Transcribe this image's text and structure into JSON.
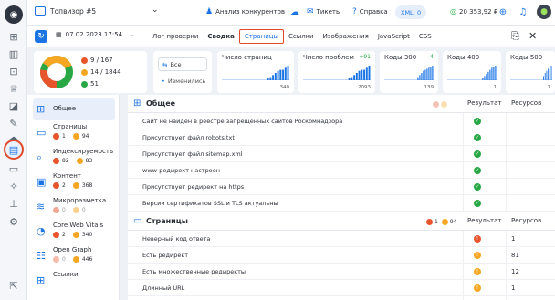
{
  "topbar": {
    "project_name": "Топвизор #5",
    "competitors": "Анализ конкурентов",
    "tickets": "Тикеты",
    "help": "Справка",
    "xml_label": "XML: 0",
    "balance": "20 353,92 ₽"
  },
  "toolbar": {
    "date": "07.02.2023 17:54",
    "tabs": [
      "Лог проверки",
      "Сводка",
      "Страницы",
      "Ссылки",
      "Изображения",
      "JavaScript",
      "CSS"
    ],
    "active_tab": "Страницы"
  },
  "summary": {
    "errors": "9 / 167",
    "warnings": "14 / 1844",
    "ok": "51",
    "filter_all": "Все",
    "filter_changed": "Изменились",
    "metrics": [
      {
        "title": "Число страниц",
        "delta": "—",
        "value": "340",
        "bars": [
          0,
          0,
          0,
          0,
          0,
          0,
          0,
          0,
          0,
          0,
          0,
          0,
          0,
          0,
          0,
          0,
          0,
          0,
          2,
          3,
          5,
          7,
          9,
          10,
          10,
          12,
          14
        ]
      },
      {
        "title": "Число проблем",
        "delta": "+91",
        "value": "2093",
        "bars": [
          0,
          0,
          0,
          0,
          0,
          0,
          0,
          0,
          0,
          0,
          0,
          0,
          0,
          0,
          0,
          0,
          0,
          0,
          2,
          3,
          5,
          7,
          9,
          10,
          10,
          12,
          14
        ]
      },
      {
        "title": "Коды 300",
        "delta": "−4",
        "value": "139",
        "bars": [
          0,
          0,
          0,
          0,
          0,
          0,
          0,
          0,
          0,
          0,
          0,
          0,
          0,
          0,
          0,
          0,
          0,
          0,
          3,
          5,
          7,
          9,
          10,
          11,
          12,
          13,
          14
        ]
      },
      {
        "title": "Коды 400",
        "delta": "—",
        "value": "1",
        "bars": [
          0,
          0,
          0,
          0,
          0,
          0,
          0,
          0,
          0,
          0,
          0,
          0,
          0,
          0,
          0,
          0,
          0,
          0,
          0,
          2,
          4,
          6,
          8,
          10,
          12,
          13,
          14
        ]
      },
      {
        "title": "Коды 500",
        "delta": "—",
        "value": "1",
        "bars": [
          0,
          0,
          0,
          0,
          0,
          0,
          0,
          0,
          0,
          0,
          0,
          0,
          0,
          0,
          0,
          0,
          0,
          0,
          0,
          0,
          0,
          4,
          7,
          9,
          11,
          13,
          14
        ]
      }
    ]
  },
  "leftnav": [
    {
      "label": "Общее",
      "icon": "grid-icon",
      "err": "",
      "warn": "",
      "active": true
    },
    {
      "label": "Страницы",
      "icon": "page-icon",
      "err": "1",
      "warn": "94"
    },
    {
      "label": "Индексируемость",
      "icon": "search-icon",
      "err": "82",
      "warn": "83"
    },
    {
      "label": "Контент",
      "icon": "content-icon",
      "err": "2",
      "warn": "368"
    },
    {
      "label": "Микроразметка",
      "icon": "markup-icon",
      "err": "0",
      "warn": "0"
    },
    {
      "label": "Core Web Vitals",
      "icon": "gauge-icon",
      "err": "2",
      "warn": "340"
    },
    {
      "label": "Open Graph",
      "icon": "og-icon",
      "err": "0",
      "warn": "446"
    },
    {
      "label": "Ссылки",
      "icon": "links-icon",
      "err": "",
      "warn": ""
    }
  ],
  "sections": [
    {
      "title": "Общее",
      "col_result": "Результат",
      "col_resources": "Ресурсов",
      "rows": [
        {
          "label": "Сайт не найден в реестре запрещенных сайтов Роскомнадзора",
          "status": "ok",
          "value": ""
        },
        {
          "label": "Присутствует файл robots.txt",
          "status": "ok",
          "value": ""
        },
        {
          "label": "Присутствует файл sitemap.xml",
          "status": "ok",
          "value": ""
        },
        {
          "label": "www-редирект настроен",
          "status": "ok",
          "value": ""
        },
        {
          "label": "Присутствует редирект на https",
          "status": "ok",
          "value": ""
        },
        {
          "label": "Версии сертификатов SSL и TLS актуальны",
          "status": "ok",
          "value": ""
        }
      ]
    },
    {
      "title": "Страницы",
      "badge_err": "1",
      "badge_warn": "94",
      "col_result": "Результат",
      "col_resources": "Ресурсов",
      "rows": [
        {
          "label": "Неверный код ответа",
          "status": "err",
          "value": "1"
        },
        {
          "label": "Есть редирект",
          "status": "warn",
          "value": "81"
        },
        {
          "label": "Есть множественные редиректы",
          "status": "warn",
          "value": "12"
        },
        {
          "label": "Длинный URL",
          "status": "warn",
          "value": "1"
        }
      ]
    }
  ],
  "colors": {
    "accent": "#1b74e4",
    "error": "#e8542b",
    "warning": "#f5a623",
    "ok": "#28a745",
    "highlight": "#e04a2a"
  }
}
